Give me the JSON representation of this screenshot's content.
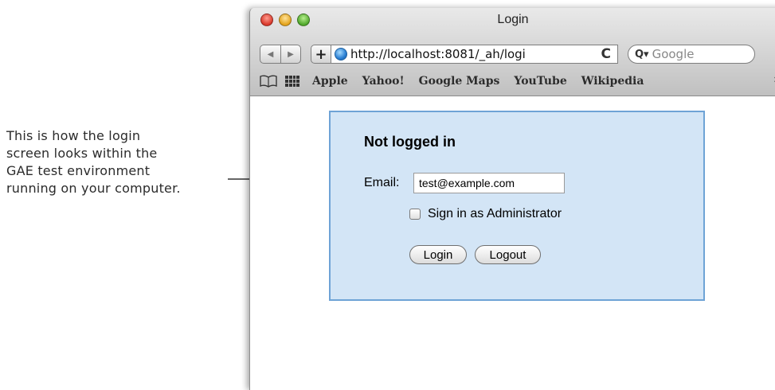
{
  "annotation": {
    "lines": [
      "This is how the login",
      "screen looks within the",
      "GAE test environment",
      "running on your computer."
    ]
  },
  "browser": {
    "title": "Login",
    "add_button": "+",
    "url": "http://localhost:8081/_ah/logi",
    "reload_glyph": "C",
    "search_placeholder": "Google",
    "bookmarks": [
      "Apple",
      "Yahoo!",
      "Google Maps",
      "YouTube",
      "Wikipedia"
    ],
    "more_glyph": "»",
    "traffic_colors": {
      "close": "#e0443e",
      "minimize": "#dea123",
      "zoom": "#5aaf33"
    }
  },
  "login": {
    "heading": "Not logged in",
    "email_label": "Email:",
    "email_value": "test@example.com",
    "admin_label": "Sign in as Administrator",
    "admin_checked": false,
    "login_button": "Login",
    "logout_button": "Logout",
    "box_color": "#d3e5f6",
    "border_color": "#6ea3d6"
  }
}
